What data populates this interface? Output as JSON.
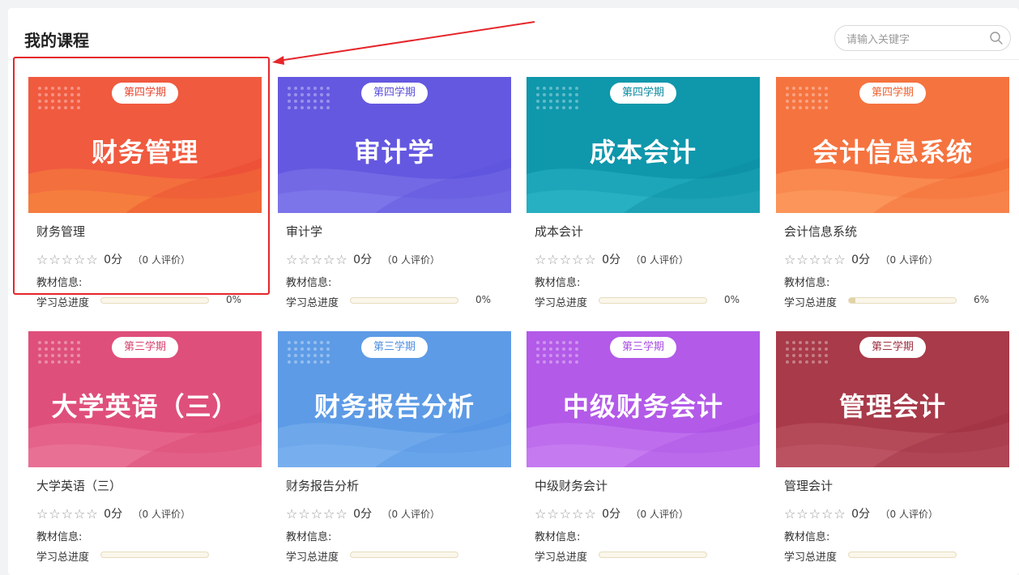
{
  "header": {
    "title": "我的课程",
    "search_placeholder": "请输入关键字"
  },
  "labels": {
    "score_suffix": "分",
    "book_info": "教材信息:",
    "progress": "学习总进度"
  },
  "courses": [
    {
      "term": "第四学期",
      "cover_title": "财务管理",
      "name": "财务管理",
      "score": "0",
      "reviews": "（0 人评价）",
      "progress": "0%",
      "progress_value": 0,
      "colors": [
        "#f05a3f",
        "#e8462e",
        "#f6813e"
      ]
    },
    {
      "term": "第四学期",
      "cover_title": "审计学",
      "name": "审计学",
      "score": "0",
      "reviews": "（0 人评价）",
      "progress": "0%",
      "progress_value": 0,
      "colors": [
        "#6458e0",
        "#5a4fdb",
        "#7f78ea"
      ]
    },
    {
      "term": "第四学期",
      "cover_title": "成本会计",
      "name": "成本会计",
      "score": "0",
      "reviews": "（0 人评价）",
      "progress": "0%",
      "progress_value": 0,
      "colors": [
        "#0f97ac",
        "#0b8a9f",
        "#2ab3c4"
      ]
    },
    {
      "term": "第四学期",
      "cover_title": "会计信息系统",
      "name": "会计信息系统",
      "score": "0",
      "reviews": "（0 人评价）",
      "progress": "6%",
      "progress_value": 6,
      "colors": [
        "#f5733f",
        "#f0622f",
        "#fb9a5c"
      ]
    },
    {
      "term": "第三学期",
      "cover_title": "大学英语（三）",
      "name": "大学英语（三）",
      "score": "0",
      "reviews": "（0 人评价）",
      "progress": "",
      "progress_value": 0,
      "colors": [
        "#df4f7b",
        "#d6436e",
        "#ea7498"
      ]
    },
    {
      "term": "第三学期",
      "cover_title": "财务报告分析",
      "name": "财务报告分析",
      "score": "0",
      "reviews": "（0 人评价）",
      "progress": "",
      "progress_value": 0,
      "colors": [
        "#5d9be6",
        "#4e8ee3",
        "#7bb2ef"
      ]
    },
    {
      "term": "第三学期",
      "cover_title": "中级财务会计",
      "name": "中级财务会计",
      "score": "0",
      "reviews": "（0 人评价）",
      "progress": "",
      "progress_value": 0,
      "colors": [
        "#b35ae8",
        "#a84de2",
        "#c77ff0"
      ]
    },
    {
      "term": "第三学期",
      "cover_title": "管理会计",
      "name": "管理会计",
      "score": "0",
      "reviews": "（0 人评价）",
      "progress": "",
      "progress_value": 0,
      "colors": [
        "#a83a49",
        "#9c2f3f",
        "#bd5665"
      ]
    }
  ]
}
